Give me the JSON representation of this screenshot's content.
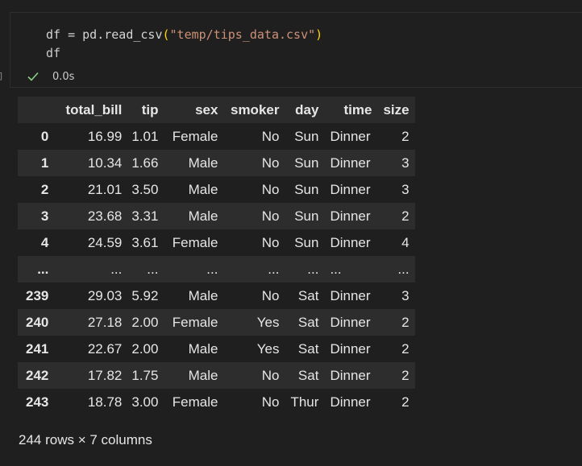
{
  "code_cell": {
    "line1": {
      "var": "df",
      "op": " = ",
      "fn": "pd.read_csv",
      "open": "(",
      "arg": "\"temp/tips_data.csv\"",
      "close": ")"
    },
    "line2": "df",
    "exec_bracket": "]",
    "exec_time": "0.0s",
    "status_icon": "check-icon"
  },
  "dataframe": {
    "columns": [
      "",
      "total_bill",
      "tip",
      "sex",
      "smoker",
      "day",
      "time",
      "size"
    ],
    "rows": [
      [
        "0",
        "16.99",
        "1.01",
        "Female",
        "No",
        "Sun",
        "Dinner",
        "2"
      ],
      [
        "1",
        "10.34",
        "1.66",
        "Male",
        "No",
        "Sun",
        "Dinner",
        "3"
      ],
      [
        "2",
        "21.01",
        "3.50",
        "Male",
        "No",
        "Sun",
        "Dinner",
        "3"
      ],
      [
        "3",
        "23.68",
        "3.31",
        "Male",
        "No",
        "Sun",
        "Dinner",
        "2"
      ],
      [
        "4",
        "24.59",
        "3.61",
        "Female",
        "No",
        "Sun",
        "Dinner",
        "4"
      ],
      [
        "...",
        "...",
        "...",
        "...",
        "...",
        "...",
        "...",
        "..."
      ],
      [
        "239",
        "29.03",
        "5.92",
        "Male",
        "No",
        "Sat",
        "Dinner",
        "3"
      ],
      [
        "240",
        "27.18",
        "2.00",
        "Female",
        "Yes",
        "Sat",
        "Dinner",
        "2"
      ],
      [
        "241",
        "22.67",
        "2.00",
        "Male",
        "Yes",
        "Sat",
        "Dinner",
        "2"
      ],
      [
        "242",
        "17.82",
        "1.75",
        "Male",
        "No",
        "Sat",
        "Dinner",
        "2"
      ],
      [
        "243",
        "18.78",
        "3.00",
        "Female",
        "No",
        "Thur",
        "Dinner",
        "2"
      ]
    ],
    "shape_text": "244 rows × 7 columns"
  },
  "colors": {
    "background": "#1f1f1f",
    "success": "#89d185",
    "string": "#ce9178",
    "function": "#dcdcaa",
    "paren": "#ffd700"
  }
}
